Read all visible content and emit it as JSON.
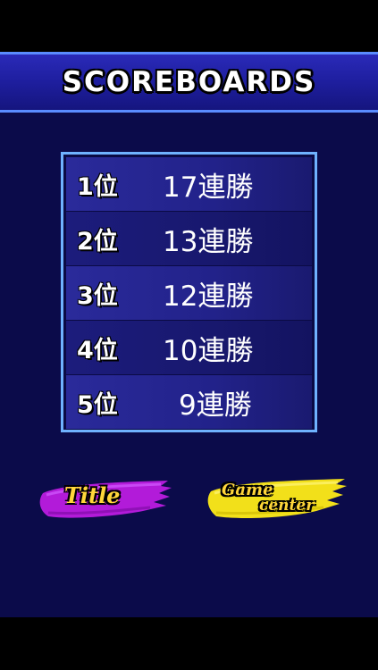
{
  "header": {
    "title": "SCOREBOARDS"
  },
  "scoreboard": {
    "rows": [
      {
        "rank": "1位",
        "streak": "17連勝"
      },
      {
        "rank": "2位",
        "streak": "13連勝"
      },
      {
        "rank": "3位",
        "streak": "12連勝"
      },
      {
        "rank": "4位",
        "streak": "10連勝"
      },
      {
        "rank": "5位",
        "streak": "9連勝"
      }
    ]
  },
  "buttons": {
    "title_label": "Title",
    "gamecenter_line1": "Game",
    "gamecenter_line2": "center"
  },
  "colors": {
    "title_brush": "#b21bd9",
    "gamecenter_brush": "#f2e01a",
    "label_yellow": "#ffd63a",
    "banner_blue": "#1e1e9e",
    "board_border": "#6fb2ff"
  }
}
